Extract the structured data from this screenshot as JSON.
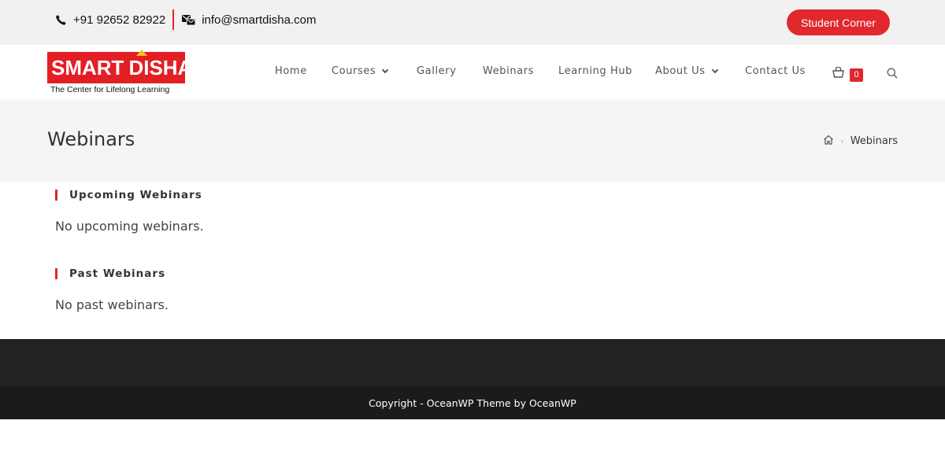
{
  "topbar": {
    "phone": "+91 92652 82922",
    "email": "info@smartdisha.com",
    "student_corner": "Student Corner"
  },
  "logo": {
    "brand_left": "SMART",
    "brand_right": "DISHA",
    "tagline": "The Center for  Lifelong Learning"
  },
  "nav": {
    "items": [
      {
        "label": "Home"
      },
      {
        "label": "Courses"
      },
      {
        "label": "Gallery"
      },
      {
        "label": "Webinars"
      },
      {
        "label": "Learning Hub"
      },
      {
        "label": "About Us"
      },
      {
        "label": "Contact Us"
      }
    ],
    "cart_count": "0"
  },
  "page": {
    "title": "Webinars",
    "breadcrumb_current": "Webinars"
  },
  "sections": {
    "upcoming": {
      "heading": "Upcoming Webinars",
      "message": "No upcoming webinars."
    },
    "past": {
      "heading": "Past Webinars",
      "message": "No past webinars."
    }
  },
  "footer": {
    "copyright": "Copyright - OceanWP Theme by OceanWP"
  },
  "colors": {
    "accent": "#e0282d",
    "topbar_bg": "#f1f1f1",
    "title_band_bg": "#f5f5f5",
    "footer_bg": "#222222",
    "footer_bottom_bg": "#1b1b1b"
  }
}
